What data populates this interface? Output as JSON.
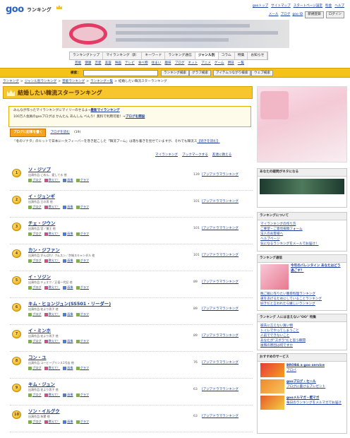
{
  "header": {
    "logo_text": "goo",
    "logo_sub": "ランキング",
    "top_links": [
      "gooトップ",
      "サイトマップ",
      "スタートページ設定",
      "料金",
      "ヘルプ"
    ],
    "account_links": [
      "メール",
      "ブログ",
      "goo ID"
    ],
    "register_button": "新規登録",
    "login_button": "ログイン"
  },
  "nav": {
    "tabs": [
      "ランキングトップ",
      "マイランキング（β）",
      "キーワード",
      "ランキング通信",
      "ジャンル別",
      "コラム",
      "特集",
      "お知らせ"
    ],
    "active_tab": "ジャンル別",
    "subnav": [
      "芸能",
      "健康",
      "恋愛",
      "美容",
      "映画",
      "テレビ",
      "食べ物",
      "住まい",
      "趣味",
      "ブログ",
      "ネット",
      "アニメ",
      "ゲーム",
      "明日",
      "一覧"
    ]
  },
  "search": {
    "label": "検索：",
    "buttons": [
      "ランキング検索",
      "グラフ検索",
      "アイテムつながり検索",
      "ウェブ検索"
    ]
  },
  "breadcrumb": [
    "ランキング",
    "ジャンル別ランキング",
    "芸能ランキング",
    "ランキング一覧",
    "結婚したい韓流スターランキング"
  ],
  "page_title": "結婚したい韓流スターランキング",
  "info": {
    "line1_prefix": "みんなが作ったマイランキングにマイリーのせるよ→",
    "line1_link": "最新マイランキング",
    "line2_prefix": "100万人会員のgooブログは かんたん あんしん べんり！無料で利用可能！→",
    "line2_link": "ブログを開設"
  },
  "blog": {
    "write_button": "ブログに記事を書く",
    "read_link": "ブログを読む",
    "read_count": "(19)"
  },
  "description": "『冬のソナタ』のヒットで日本に一大フィーバーを巻き起こした「韓流ブーム」は落ち着きを見せていますが、それでも韓流ス",
  "description_more": "【続きを読む】",
  "actions": [
    "マイランキング",
    "ブックマークする",
    "友達に教える"
  ],
  "item_actions": [
    "ブログ",
    "教えて！",
    "画像",
    "グラフ"
  ],
  "category_link": "[アジアドラマランキング",
  "rankings": [
    {
      "rank": "1",
      "name": "ソ・ジソプ",
      "sub": "出演作品:ごめん、愛してる 他",
      "count": "139"
    },
    {
      "rank": "2",
      "name": "イ・ジュンギ",
      "sub": "出演作品:王の男 他",
      "count": "101"
    },
    {
      "rank": "3",
      "name": "チェ・ジウン",
      "sub": "出演作品:宮／僕王 他",
      "count": "101"
    },
    {
      "rank": "4",
      "name": "カン・ジファン",
      "sub": "出演作品:がんばれ！クムスン／京城スキャンダル 他",
      "count": "101"
    },
    {
      "rank": "5",
      "name": "イ・ソジン",
      "sub": "出演作品:チェオク／正祖一代記 他",
      "count": "89"
    },
    {
      "rank": "6",
      "name": "キム・ヒョンジュン(SS501・リーダー)",
      "sub": "出演作品:花より男子 他",
      "count": "89"
    },
    {
      "rank": "7",
      "name": "イ・ミンホ",
      "sub": "出演作品:花より男子 他",
      "count": "89"
    },
    {
      "rank": "8",
      "name": "コン・ユ",
      "sub": "出演作品:コーヒープリンス1号店 他",
      "count": "76"
    },
    {
      "rank": "9",
      "name": "キム・ジュン",
      "sub": "出演作品:花より男子 他",
      "count": "63"
    },
    {
      "rank": "10",
      "name": "ソン・イルグク",
      "sub": "出演作品:朱蒙 他",
      "count": "63"
    }
  ],
  "sidebar": {
    "survey_title": "あなたの疑問がネタになる",
    "about_title": "ランキングについて",
    "about_links": [
      "マイランキングの作り方",
      "ご要望・ご意見投稿フォーム",
      "法人のお客様へ",
      "ヘルプページ",
      "気になるランキングをメールでお届け！"
    ],
    "news_title": "ランキング通信",
    "news_feature": "今年のバレンタイン あなたはどう過ごす？",
    "news_links": [
      "晩ご飯に作りたい簡単料理ランキング",
      "運をあげるためにしていることランキング",
      "好きだと言われたら嬉しいランキング"
    ],
    "special_title": "ランキング 人には言えない\"OO\" 特集",
    "special_links": [
      "彼氏に言えない買い物",
      "トイレでやってしまうこと",
      "人前でできないこと",
      "あなたが\"ズボラ\"だと思う瞬間",
      "後悔の原因は何ですか"
    ],
    "services_title": "おすすめのサービス",
    "services": [
      {
        "title": "BROBA a goo service",
        "text": "ブロバ"
      },
      {
        "title": "gooブログ・セール",
        "text": "ブログに書けるプレゼント"
      },
      {
        "title": "gooメルマガ・壁マガ",
        "text": "毎日のランキングをメルマガでお届け"
      }
    ]
  }
}
